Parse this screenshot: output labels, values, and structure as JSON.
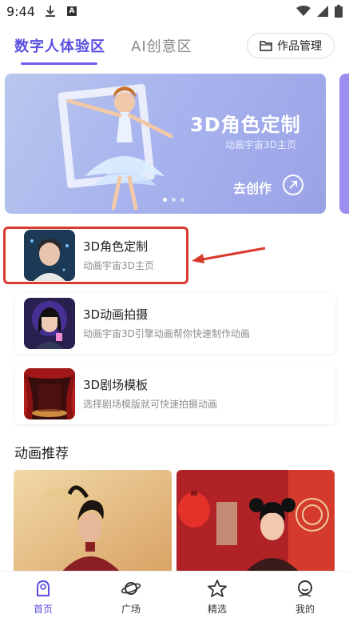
{
  "status": {
    "time": "9:44"
  },
  "tabs": [
    {
      "label": "数字人体验区"
    },
    {
      "label": "AI创意区"
    }
  ],
  "works_button": {
    "label": "作品管理"
  },
  "banner": {
    "title": "3D角色定制",
    "subtitle": "动画宇宙3D主页",
    "cta": "去创作"
  },
  "list": [
    {
      "title": "3D角色定制",
      "subtitle": "动画宇宙3D主页"
    },
    {
      "title": "3D动画拍摄",
      "subtitle": "动画宇宙3D引擎动画帮你快速制作动画"
    },
    {
      "title": "3D剧场模板",
      "subtitle": "选择剧场模版就可快速拍摄动画"
    }
  ],
  "section": {
    "title": "动画推荐"
  },
  "nav": [
    {
      "label": "首页"
    },
    {
      "label": "广场"
    },
    {
      "label": "精选"
    },
    {
      "label": "我的"
    }
  ],
  "colors": {
    "accent": "#5a4fe0",
    "highlight": "#d83a2e"
  }
}
